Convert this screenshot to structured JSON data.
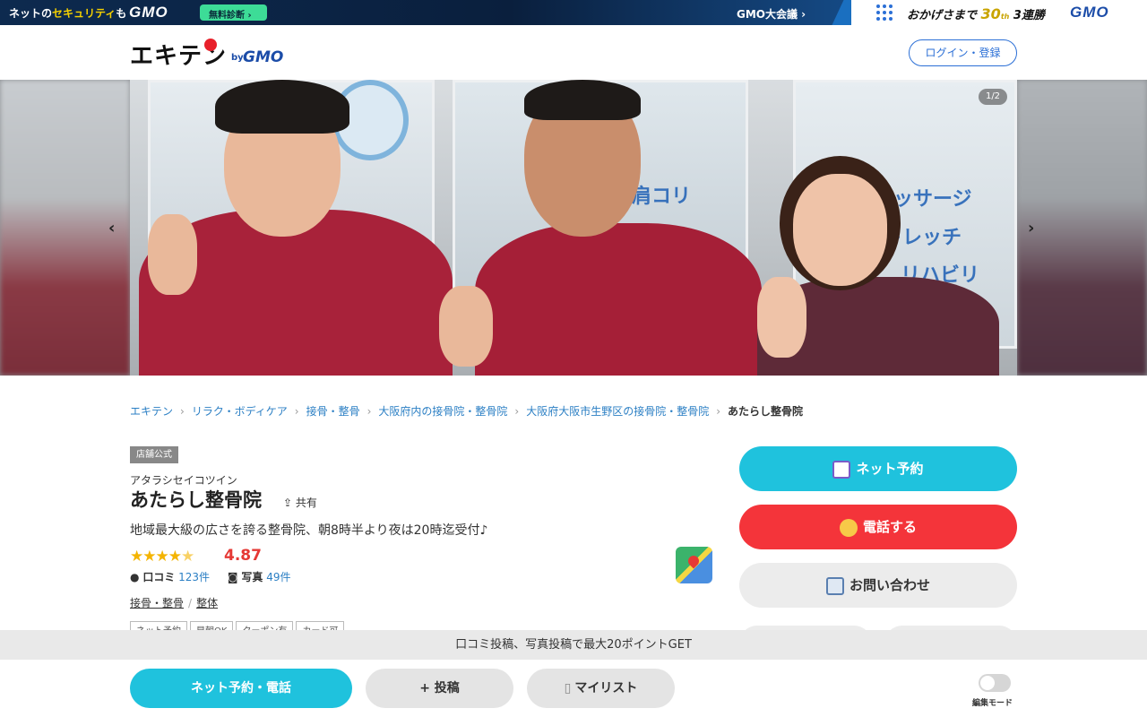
{
  "gmo_bar": {
    "net_text": "ネットの",
    "security_text": "セキュリティ",
    "mo_text": "も",
    "gmo": "GMO",
    "diagnosis": "無料診断 ›",
    "meeting": "GMO大会議 ›",
    "okagesama": "おかげさまで",
    "thirty": "30",
    "th": "th",
    "consecutive": "3連勝",
    "gmo_right": "GMO"
  },
  "header": {
    "logo_text": "エキテン",
    "logo_by": "by",
    "logo_gmo": "GMO",
    "login_label": "ログイン・登録"
  },
  "hero": {
    "counter": "1/2",
    "prev_arrow": "‹",
    "next_arrow": "›",
    "window_text_1": "肩コリ",
    "window_text_2": "マッサージ",
    "window_text_3": "トレッチ",
    "window_text_4": "リハビリ"
  },
  "breadcrumb": {
    "items": [
      "エキテン",
      "リラク・ボディケア",
      "接骨・整骨",
      "大阪府内の接骨院・整骨院",
      "大阪府大阪市生野区の接骨院・整骨院"
    ],
    "separator": "›",
    "current": "あたらし整骨院"
  },
  "shop": {
    "official_badge": "店舗公式",
    "reading": "アタラシセイコツイン",
    "name": "あたらし整骨院",
    "share_label": "共有",
    "catch_copy": "地域最大級の広さを誇る整骨院、朝8時半より夜は20時迄受付♪",
    "stars": "★★★★",
    "half_star": "★",
    "rating": "4.87",
    "review_label": "口コミ",
    "review_count": "123件",
    "photo_label": "写真",
    "photo_count": "49件",
    "categories": [
      "接骨・整骨",
      "整体"
    ],
    "category_sep": "/",
    "tags": [
      "ネット予約",
      "早朝OK",
      "クーポン有",
      "カード可"
    ]
  },
  "actions": {
    "reserve": "ネット予約",
    "call": "電話する",
    "inquiry": "お問い合わせ"
  },
  "point_bar": {
    "text": "口コミ投稿、写真投稿で最大20ポイントGET"
  },
  "bottom_bar": {
    "reserve_call": "ネット予約・電話",
    "post": "+ 投稿",
    "mylist": "マイリスト",
    "edit_mode": "編集モード"
  },
  "colors": {
    "accent_cyan": "#1fc2dd",
    "call_red": "#f4343a",
    "rating_red": "#e53935",
    "star_yellow": "#f4b400",
    "link_blue": "#2b7fc4"
  }
}
